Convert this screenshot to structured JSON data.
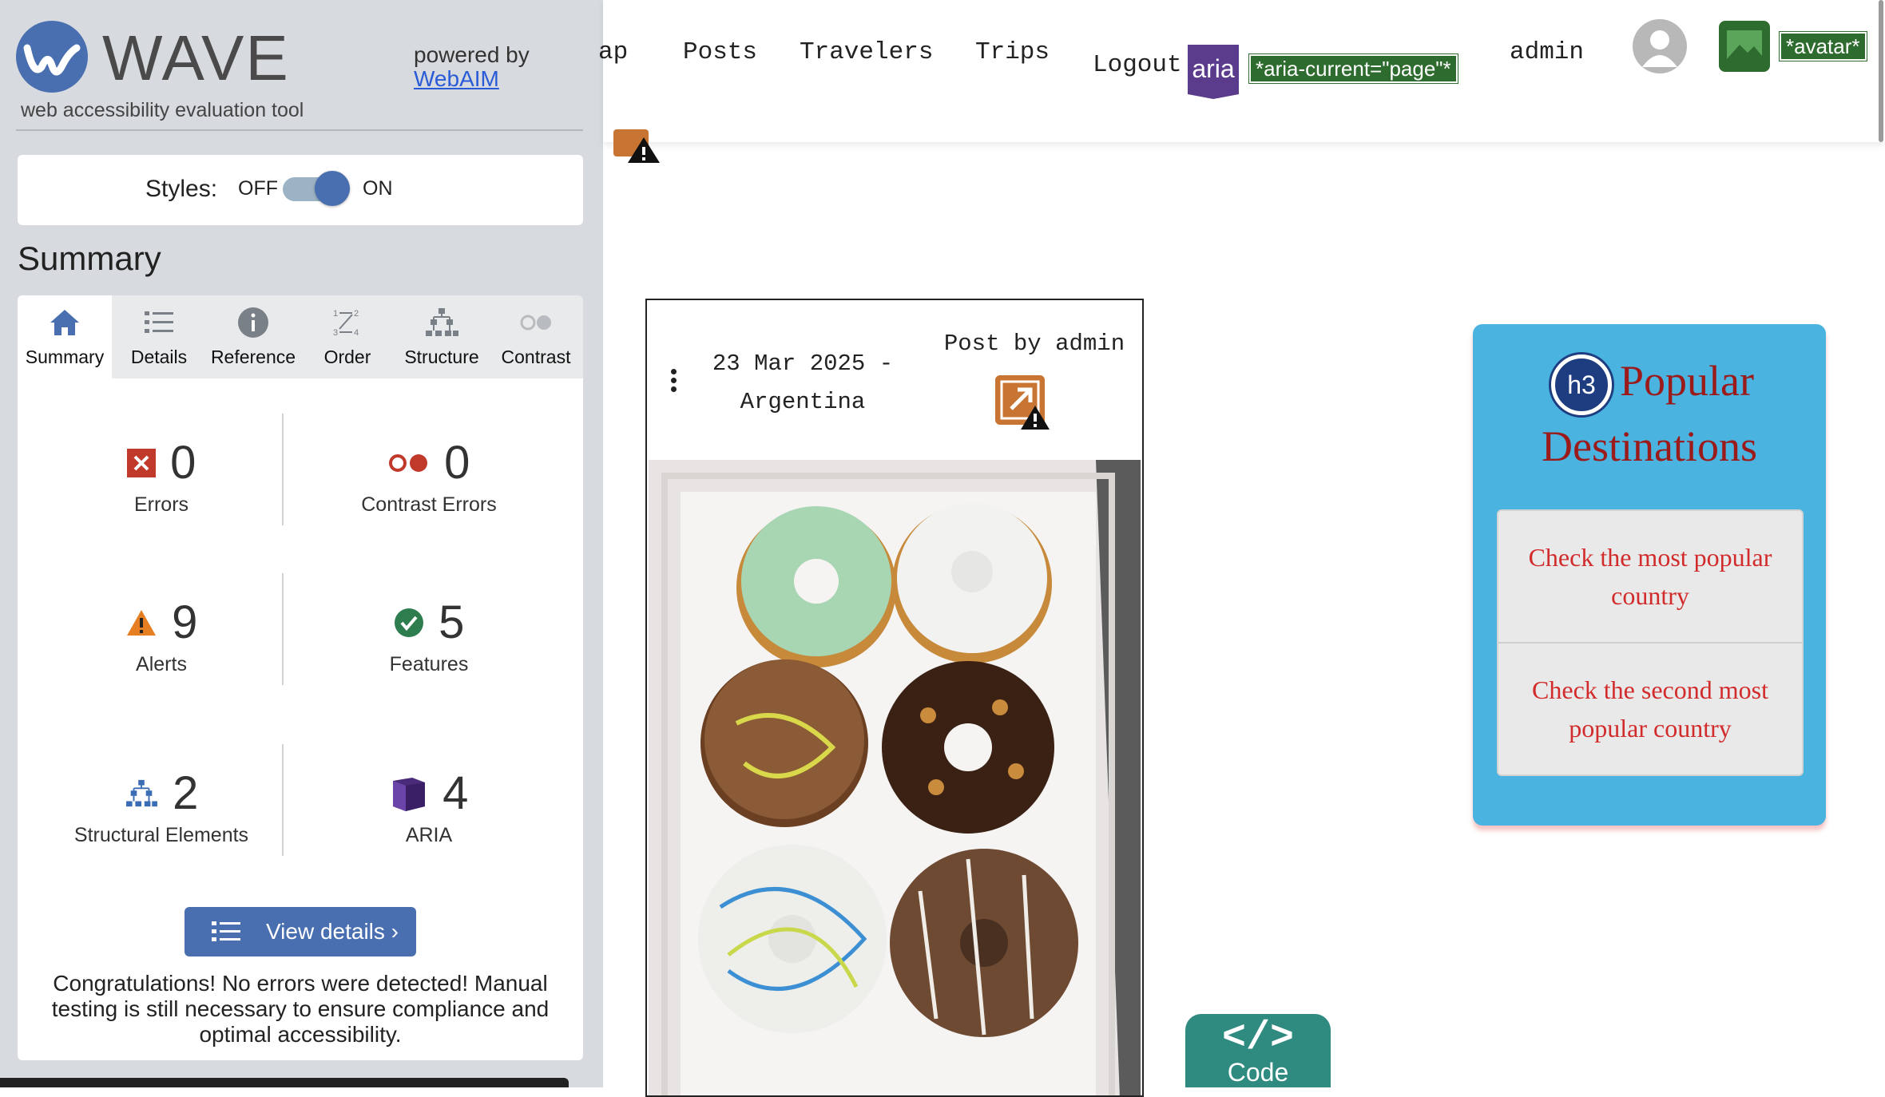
{
  "wave": {
    "title": "WAVE",
    "subtitle": "web accessibility evaluation tool",
    "powered_by": "powered by",
    "webaim_link": "WebAIM",
    "styles_label": "Styles:",
    "toggle_off": "OFF",
    "toggle_on": "ON",
    "styles_enabled": true,
    "summary_heading": "Summary",
    "tabs": [
      {
        "label": "Summary",
        "icon": "home-icon",
        "active": true
      },
      {
        "label": "Details",
        "icon": "list-icon",
        "active": false
      },
      {
        "label": "Reference",
        "icon": "info-icon",
        "active": false
      },
      {
        "label": "Order",
        "icon": "order-icon",
        "active": false
      },
      {
        "label": "Structure",
        "icon": "structure-icon",
        "active": false
      },
      {
        "label": "Contrast",
        "icon": "contrast-icon",
        "active": false
      }
    ],
    "stats": {
      "errors": {
        "count": "0",
        "label": "Errors",
        "icon": "error-icon"
      },
      "contrast_errors": {
        "count": "0",
        "label": "Contrast Errors",
        "icon": "contrast-error-icon"
      },
      "alerts": {
        "count": "9",
        "label": "Alerts",
        "icon": "alert-icon"
      },
      "features": {
        "count": "5",
        "label": "Features",
        "icon": "feature-check-icon"
      },
      "structural": {
        "count": "2",
        "label": "Structural Elements",
        "icon": "structure-icon"
      },
      "aria": {
        "count": "4",
        "label": "ARIA",
        "icon": "aria-cube-icon"
      }
    },
    "view_details": "View details ›",
    "congrats": "Congratulations! No errors were detected! Manual testing is still necessary to ensure compliance and optimal accessibility."
  },
  "header": {
    "nav": [
      "Map",
      "Posts",
      "Travelers",
      "Trips"
    ],
    "nav_visible_partial": "ap",
    "logout": "Logout",
    "aria_badge": "aria",
    "aria_current_tag": "*aria-current=\"page\"*",
    "username": "admin",
    "avatar_tag": "*avatar*"
  },
  "post": {
    "date_line1": "23 Mar 2025 -",
    "date_line2": "Argentina",
    "by": "Post by admin",
    "photo_icon": "donuts-photo"
  },
  "destinations": {
    "heading_badge": "h3",
    "heading_line1": "Popular",
    "heading_line2": "Destinations",
    "items": [
      "Check the most popular country",
      "Check the second most popular country"
    ]
  },
  "code_tab": {
    "symbol": "</>",
    "label": "Code"
  },
  "colors": {
    "wave_blue": "#4a6fb0",
    "aria_purple": "#5b3b8c",
    "tag_green": "#2e6b2e",
    "dest_bg": "#4ab3df",
    "dest_title": "#9b1b1b",
    "dest_link": "#d22b2b",
    "code_tab": "#2f8a7f"
  }
}
